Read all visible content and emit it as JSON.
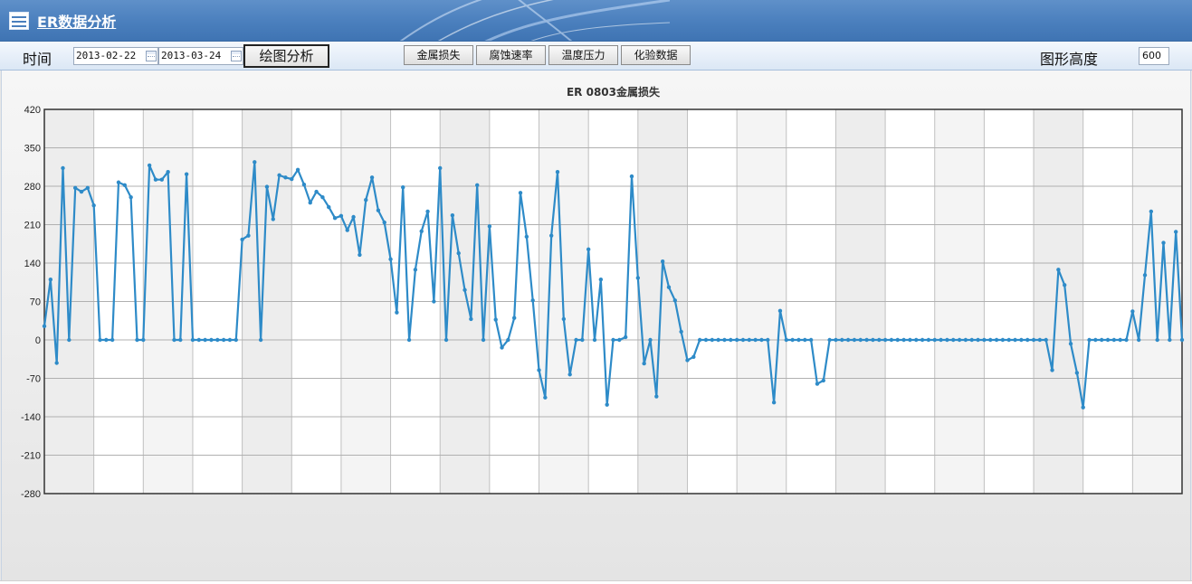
{
  "header": {
    "title": "ER数据分析",
    "icon": "table-grid-icon"
  },
  "toolbar": {
    "time_label": "时间",
    "start_date": "2013-02-22",
    "end_date": "2013-03-24",
    "draw_button": "绘图分析",
    "tabs": [
      "金属损失",
      "腐蚀速率",
      "温度压力",
      "化验数据"
    ],
    "height_label": "图形高度",
    "height_value": "600"
  },
  "chart_data": {
    "type": "line",
    "title": "ER 0803金属损失",
    "xlabel": "",
    "ylabel": "",
    "ylim": [
      -280,
      420
    ],
    "yticks": [
      420,
      350,
      280,
      210,
      140,
      70,
      0,
      -70,
      -140,
      -210,
      -280
    ],
    "grid": true,
    "line_color": "#2e8bc8",
    "x": [
      1,
      2,
      3,
      4,
      5,
      6,
      7,
      8,
      9,
      10,
      11,
      12,
      13,
      14,
      15,
      16,
      17,
      18,
      19,
      20,
      21,
      22,
      23,
      24,
      25,
      26,
      27,
      28,
      29,
      30,
      31,
      32,
      33,
      34,
      35,
      36,
      37,
      38,
      39,
      40,
      41,
      42,
      43,
      44,
      45,
      46,
      47,
      48,
      49,
      50,
      51,
      52,
      53,
      54,
      55,
      56,
      57,
      58,
      59,
      60,
      61,
      62,
      63,
      64,
      65,
      66,
      67,
      68,
      69,
      70,
      71,
      72,
      73,
      74,
      75,
      76,
      77,
      78,
      79,
      80,
      81,
      82,
      83,
      84,
      85,
      86,
      87,
      88,
      89,
      90,
      91,
      92,
      93,
      94,
      95,
      96,
      97,
      98,
      99,
      100,
      101,
      102,
      103,
      104,
      105,
      106,
      107,
      108,
      109,
      110,
      111,
      112,
      113,
      114,
      115,
      116,
      117,
      118,
      119,
      120,
      121,
      122,
      123,
      124,
      125,
      126,
      127,
      128,
      129,
      130,
      131,
      132,
      133,
      134,
      135,
      136,
      137,
      138,
      139,
      140,
      141,
      142,
      143,
      144,
      145,
      146,
      147,
      148,
      149,
      150,
      151,
      152,
      153,
      154,
      155,
      156,
      157,
      158,
      159,
      160,
      161,
      162,
      163,
      164,
      165,
      166,
      167,
      168,
      169,
      170,
      171,
      172,
      173,
      174,
      175,
      176,
      177,
      178,
      179,
      180,
      181,
      182,
      183
    ],
    "values": [
      25,
      110,
      -42,
      313,
      0,
      277,
      270,
      277,
      245,
      0,
      0,
      0,
      287,
      282,
      260,
      0,
      0,
      318,
      292,
      292,
      306,
      0,
      0,
      302,
      0,
      0,
      0,
      0,
      0,
      0,
      0,
      0,
      183,
      190,
      324,
      0,
      279,
      220,
      300,
      296,
      293,
      310,
      283,
      250,
      270,
      260,
      242,
      222,
      226,
      200,
      224,
      155,
      255,
      296,
      236,
      214,
      147,
      50,
      278,
      0,
      128,
      198,
      234,
      70,
      313,
      0,
      227,
      158,
      91,
      38,
      282,
      0,
      207,
      37,
      -14,
      0,
      40,
      268,
      188,
      72,
      -55,
      -105,
      190,
      306,
      38,
      -63,
      0,
      0,
      165,
      0,
      110,
      -118,
      0,
      0,
      5,
      298,
      113,
      -43,
      0,
      -103,
      143,
      96,
      72,
      15,
      -37,
      -31,
      0,
      0,
      0,
      0,
      0,
      0,
      0,
      0,
      0,
      0,
      0,
      0,
      -114,
      53,
      0,
      0,
      0,
      0,
      0,
      -80,
      -74,
      0,
      0,
      0,
      0,
      0,
      0,
      0,
      0,
      0,
      0,
      0,
      0,
      0,
      0,
      0,
      0,
      0,
      0,
      0,
      0,
      0,
      0,
      0,
      0,
      0,
      0,
      0,
      0,
      0,
      0,
      0,
      0,
      0,
      0,
      0,
      0,
      -55,
      128,
      100,
      -7,
      -60,
      -123,
      0,
      0,
      0,
      0,
      0,
      0,
      0,
      52,
      0,
      118,
      234,
      0,
      177,
      0,
      197,
      0
    ]
  }
}
